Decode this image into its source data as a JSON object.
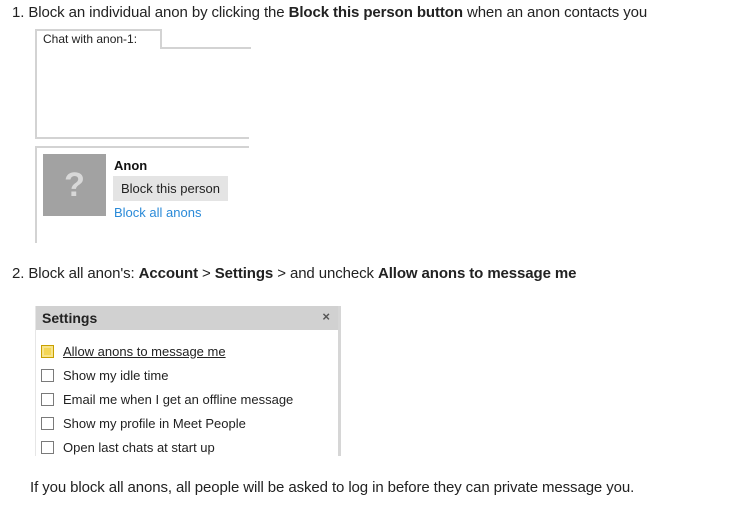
{
  "step1": {
    "prefix": "1. Block an individual anon by clicking the ",
    "bold": "Block this person button",
    "suffix": " when an anon contacts you"
  },
  "chat": {
    "tab_label": "Chat with anon-1:"
  },
  "profile": {
    "avatar_glyph": "?",
    "name": "Anon",
    "block_button": "Block this person",
    "block_all_link": "Block all anons",
    "link_color": "#2a8ad8"
  },
  "step2": {
    "prefix": "2. Block all anon's: ",
    "account": "Account",
    "sep1": " > ",
    "settings": "Settings",
    "sep2": " > and uncheck ",
    "option": "Allow anons to message me"
  },
  "settings_panel": {
    "title": "Settings",
    "close_glyph": "×",
    "items": [
      {
        "label": "Allow anons to message me",
        "checked": false,
        "focused": true
      },
      {
        "label": "Show my idle time",
        "checked": false,
        "focused": false
      },
      {
        "label": "Email me when I get an offline message",
        "checked": false,
        "focused": false
      },
      {
        "label": "Show my profile in Meet People",
        "checked": false,
        "focused": false
      },
      {
        "label": "Open last chats at start up",
        "checked": false,
        "focused": false
      }
    ]
  },
  "note": "If you block all anons, all people will be asked to log in before they can private message you."
}
